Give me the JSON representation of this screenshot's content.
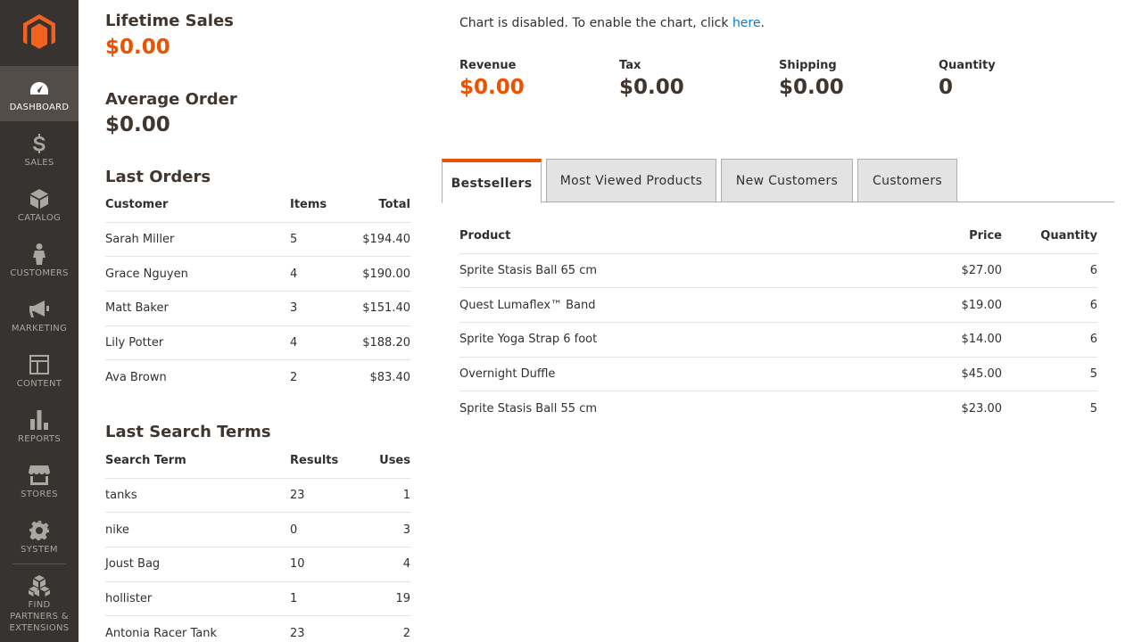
{
  "sidebar": {
    "items": [
      {
        "label": "Dashboard",
        "icon": "dashboard-icon"
      },
      {
        "label": "Sales",
        "icon": "dollar-icon"
      },
      {
        "label": "Catalog",
        "icon": "box-icon"
      },
      {
        "label": "Customers",
        "icon": "person-icon"
      },
      {
        "label": "Marketing",
        "icon": "megaphone-icon"
      },
      {
        "label": "Content",
        "icon": "layout-icon"
      },
      {
        "label": "Reports",
        "icon": "bar-chart-icon"
      },
      {
        "label": "Stores",
        "icon": "store-icon"
      },
      {
        "label": "System",
        "icon": "gear-icon"
      }
    ],
    "partners": {
      "line1": "Find",
      "line2": "Partners &",
      "line3": "Extensions"
    }
  },
  "stats": {
    "lifetime_label": "Lifetime Sales",
    "lifetime_value": "$0.00",
    "average_label": "Average Order",
    "average_value": "$0.00"
  },
  "last_orders": {
    "title": "Last Orders",
    "headers": {
      "customer": "Customer",
      "items": "Items",
      "total": "Total"
    },
    "rows": [
      {
        "customer": "Sarah Miller",
        "items": "5",
        "total": "$194.40"
      },
      {
        "customer": "Grace Nguyen",
        "items": "4",
        "total": "$190.00"
      },
      {
        "customer": "Matt Baker",
        "items": "3",
        "total": "$151.40"
      },
      {
        "customer": "Lily Potter",
        "items": "4",
        "total": "$188.20"
      },
      {
        "customer": "Ava Brown",
        "items": "2",
        "total": "$83.40"
      }
    ]
  },
  "last_search": {
    "title": "Last Search Terms",
    "headers": {
      "term": "Search Term",
      "results": "Results",
      "uses": "Uses"
    },
    "rows": [
      {
        "term": "tanks",
        "results": "23",
        "uses": "1"
      },
      {
        "term": "nike",
        "results": "0",
        "uses": "3"
      },
      {
        "term": "Joust Bag",
        "results": "10",
        "uses": "4"
      },
      {
        "term": "hollister",
        "results": "1",
        "uses": "19"
      },
      {
        "term": "Antonia Racer Tank",
        "results": "23",
        "uses": "2"
      }
    ]
  },
  "chart": {
    "message": "Chart is disabled. To enable the chart, click ",
    "link": "here",
    "period": "."
  },
  "totals": {
    "revenue_label": "Revenue",
    "revenue_value": "$0.00",
    "tax_label": "Tax",
    "tax_value": "$0.00",
    "shipping_label": "Shipping",
    "shipping_value": "$0.00",
    "quantity_label": "Quantity",
    "quantity_value": "0"
  },
  "tabs": [
    "Bestsellers",
    "Most Viewed Products",
    "New Customers",
    "Customers"
  ],
  "bestsellers": {
    "headers": {
      "product": "Product",
      "price": "Price",
      "quantity": "Quantity"
    },
    "rows": [
      {
        "product": "Sprite Stasis Ball 65 cm",
        "price": "$27.00",
        "quantity": "6"
      },
      {
        "product": "Quest Lumaflex™ Band",
        "price": "$19.00",
        "quantity": "6"
      },
      {
        "product": "Sprite Yoga Strap 6 foot",
        "price": "$14.00",
        "quantity": "6"
      },
      {
        "product": "Overnight Duffle",
        "price": "$45.00",
        "quantity": "5"
      },
      {
        "product": "Sprite Stasis Ball 55 cm",
        "price": "$23.00",
        "quantity": "5"
      }
    ]
  },
  "colors": {
    "accent": "#eb5202",
    "sidebar": "#373330",
    "link": "#007bdb"
  }
}
